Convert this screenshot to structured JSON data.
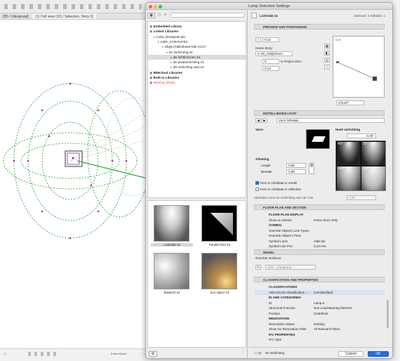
{
  "background": {
    "tab_1": "[3D / Uitergrond]",
    "tab_2": "(1) Cell view (10) / Selection, Story 0]",
    "status_left": "0",
    "status_mid": "Entire Model"
  },
  "dialog": {
    "title": "Lamp Selection Settings"
  },
  "tree": {
    "items": [
      {
        "label": "Embedded Library",
        "bold": true
      },
      {
        "label": "Linked Libraries",
        "bold": true
      },
      {
        "label": "Cuba_showpiste.plo"
      },
      {
        "label": "LIBR_3729764753"
      },
      {
        "label": "Object bibliotheek KMI 24.lcf"
      },
      {
        "label": "63 Verlichting 24"
      },
      {
        "label": "3D lichtbronnen 24"
      },
      {
        "label": "3D plaatverlichting 24"
      },
      {
        "label": "3D verlichting vast 24"
      },
      {
        "label": "BIMcloud Libraries",
        "bold": true
      },
      {
        "label": "Built-in Libraries",
        "bold": true
      },
      {
        "label": "Missing Library",
        "missing": true
      }
    ]
  },
  "thumbnails": [
    {
      "label": "Lichtvlak 24"
    },
    {
      "label": "Parallel licht 24"
    },
    {
      "label": "Bawlicht 24"
    },
    {
      "label": "Zon object 24"
    }
  ],
  "header": {
    "object_name": "Lichtvlak 24",
    "selected_status": "Selected: 1 Editable: 1"
  },
  "preview": {
    "section_title": "PREVIEW AND POSITIONING",
    "height_value": "0,12",
    "home_story_label": "Home Story:",
    "home_story_value": "0. 00_Gelijkvloers",
    "offset_value": "0",
    "project_zero_label": "to Project Zero",
    "elevation_value": "0,12",
    "angle_value": "175,87°",
    "preview_size_value": "0,00"
  },
  "light": {
    "section_title": "INSTELLINGEN LICHT",
    "nav_value": "Vorm lichtvlak...",
    "vorm_label": "Vorm",
    "hoek_label": "Hoek verlichting",
    "hoek_value": "0,00°",
    "angle_options": [
      "40°",
      "70°",
      "100°",
      "130°"
    ],
    "afmeting_label": "Afmeting",
    "lengte_label": "Lengte",
    "lengte_value": "0,85",
    "breedte_label": "Breedte",
    "breedte_value": "0,85",
    "check_render": "Vorm is zichtbaar in render",
    "check_reflect": "Vorm is zichtbaar in reflecties",
    "limit_label": "Uitstralen vorm en verlichting over de Y-as",
    "limit_value": "1,00"
  },
  "floorplan": {
    "section_title": "FLOOR PLAN AND SECTION",
    "rows": [
      {
        "col1": "FLOOR PLAN DISPLAY",
        "col2": "",
        "header": true
      },
      {
        "col1": "Show on Stories",
        "col2": "Home Story Only"
      },
      {
        "col1": "SYMBOL",
        "col2": "",
        "header": true
      },
      {
        "col1": "Override Object's Line Types",
        "col2": ""
      },
      {
        "col1": "Override Object's Pens",
        "col2": ""
      },
      {
        "col1": "Symbol Lines",
        "col2": "Volle lijn"
      },
      {
        "col1": "Symbol Line Pen",
        "col2": "0,13 mm"
      }
    ]
  },
  "model": {
    "section_title": "MODEL",
    "override_label": "Override Surfaces:",
    "surface_value": "Glas - Uitergrond"
  },
  "classification": {
    "section_title": "CLASSIFICATION AND PROPERTIES",
    "rows": [
      {
        "col1": "CLASSIFICATIONS",
        "col2": "",
        "header": true
      },
      {
        "col1": "ARCHICAD Classification -...",
        "col2": "(Unclassified)",
        "selected": true
      },
      {
        "col1": "ID AND CATEGORIES",
        "col2": "",
        "header": true
      },
      {
        "col1": "ID",
        "col2": "Lamp-a"
      },
      {
        "col1": "Structural Function",
        "col2": "Non-Load-Bearing Element"
      },
      {
        "col1": "Position",
        "col2": "Undefined"
      },
      {
        "col1": "RENOVATION",
        "col2": "",
        "header": true
      },
      {
        "col1": "Renovation Status",
        "col2": "Existing"
      },
      {
        "col1": "Show On Renovation Filter",
        "col2": "All Relevant Filters"
      },
      {
        "col1": "IFC PROPERTIES",
        "col2": "",
        "header": true
      },
      {
        "col1": "IFC Type",
        "col2": ""
      }
    ]
  },
  "footer": {
    "layer_value": "63 Verlichting",
    "cancel_label": "Cancel",
    "ok_label": "OK"
  },
  "colors": {
    "accent": "#1f6fe0",
    "missing": "#e0423a",
    "highlight": "#dcdcdc"
  }
}
